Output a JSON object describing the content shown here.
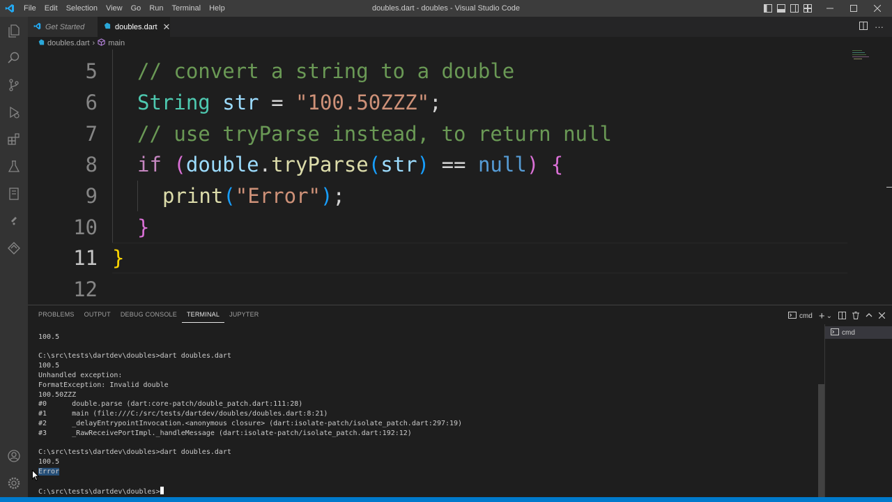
{
  "window": {
    "title": "doubles.dart - doubles - Visual Studio Code",
    "menu": [
      "File",
      "Edit",
      "Selection",
      "View",
      "Go",
      "Run",
      "Terminal",
      "Help"
    ]
  },
  "tabs": [
    {
      "label": "Get Started",
      "active": false
    },
    {
      "label": "doubles.dart",
      "active": true
    }
  ],
  "breadcrumb": {
    "file": "doubles.dart",
    "symbol": "main"
  },
  "editor": {
    "line_numbers": [
      "5",
      "6",
      "7",
      "8",
      "9",
      "10",
      "11",
      "12"
    ],
    "current_line": "11",
    "code": {
      "l5": {
        "comment": "// convert a string to a double"
      },
      "l6": {
        "type": "String",
        "var": "str",
        "eq": "=",
        "str": "\"100.50ZZZ\"",
        "semi": ";"
      },
      "l7": {
        "comment": "// use tryParse instead, to return null"
      },
      "l8": {
        "kw": "if",
        "open": "(",
        "cls": "double",
        "dot": ".",
        "fn": "tryParse",
        "p_open": "(",
        "arg": "str",
        "p_close": ")",
        "op": "==",
        "null": "null",
        "close": ")",
        "brace": "{"
      },
      "l9": {
        "fn": "print",
        "p_open": "(",
        "str": "\"Error\"",
        "p_close": ")",
        "semi": ";"
      },
      "l10": {
        "brace": "}"
      },
      "l11": {
        "brace": "}"
      }
    }
  },
  "panel": {
    "tabs": [
      "PROBLEMS",
      "OUTPUT",
      "DEBUG CONSOLE",
      "TERMINAL",
      "JUPYTER"
    ],
    "active_tab": "TERMINAL",
    "terminal_name": "cmd",
    "terminal_lines": [
      "100.5",
      "",
      "C:\\src\\tests\\dartdev\\doubles>dart doubles.dart",
      "100.5",
      "Unhandled exception:",
      "FormatException: Invalid double",
      "100.50ZZZ",
      "#0      double.parse (dart:core-patch/double_patch.dart:111:28)",
      "#1      main (file:///C:/src/tests/dartdev/doubles/doubles.dart:8:21)",
      "#2      _delayEntrypointInvocation.<anonymous closure> (dart:isolate-patch/isolate_patch.dart:297:19)",
      "#3      _RawReceivePortImpl._handleMessage (dart:isolate-patch/isolate_patch.dart:192:12)",
      "",
      "C:\\src\\tests\\dartdev\\doubles>dart doubles.dart",
      "100.5"
    ],
    "selected_line": "Error",
    "prompt": "C:\\src\\tests\\dartdev\\doubles>"
  },
  "icons": {
    "activity": [
      "explorer-icon",
      "search-icon",
      "source-control-icon",
      "run-debug-icon",
      "extensions-icon",
      "testing-icon",
      "notebook-icon",
      "flutter-icon",
      "dart-devtools-icon"
    ],
    "bottom": [
      "account-icon",
      "settings-gear-icon"
    ]
  },
  "colors": {
    "accent": "#007acc",
    "comment": "#6a9955",
    "type": "#4ec9b0",
    "variable": "#9cdcfe",
    "string": "#ce9178",
    "keyword": "#c586c0",
    "function": "#dcdcaa",
    "constant": "#569cd6"
  }
}
